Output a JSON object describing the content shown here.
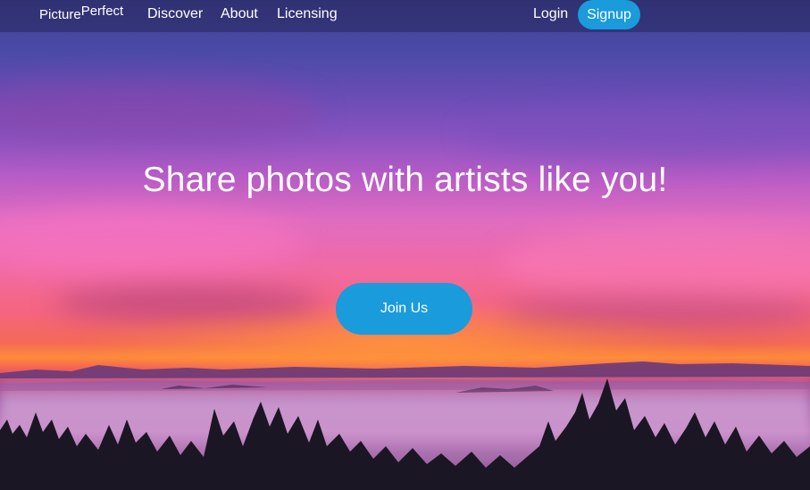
{
  "nav": {
    "brand_main": "Picture",
    "brand_sup": "Perfect",
    "links": [
      "Discover",
      "About",
      "Licensing"
    ],
    "login_label": "Login",
    "signup_label": "Signup"
  },
  "hero": {
    "headline": "Share photos with artists like you!",
    "cta_label": "Join Us",
    "background": "sunset-over-clouds-photo"
  },
  "colors": {
    "accent": "#1a9bdb",
    "navbar": "#28265c"
  }
}
